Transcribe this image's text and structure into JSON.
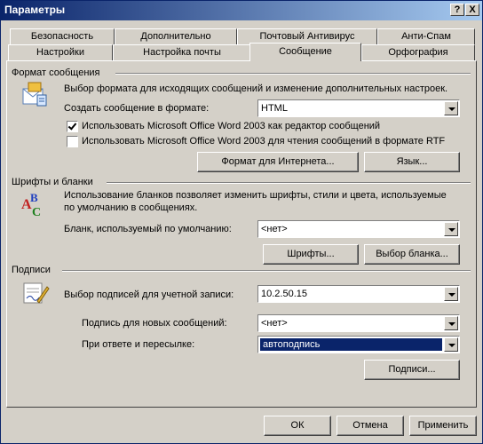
{
  "window": {
    "title": "Параметры",
    "help_label": "?",
    "close_label": "X"
  },
  "tabs_row1": [
    "Безопасность",
    "Дополнительно",
    "Почтовый Антивирус",
    "Анти-Спам"
  ],
  "tabs_row2": [
    "Настройки",
    "Настройка почты",
    "Сообщение",
    "Орфография"
  ],
  "active_tab": "Сообщение",
  "format": {
    "header": "Формат сообщения",
    "description": "Выбор формата для исходящих сообщений и изменение дополнительных настроек.",
    "create_label": "Создать сообщение в формате:",
    "create_value": "HTML",
    "use_word_editor_label": "Использовать Microsoft Office Word 2003 как редактор сообщений",
    "use_word_editor_checked": true,
    "use_word_reader_label": "Использовать Microsoft Office Word 2003 для чтения сообщений в формате RTF",
    "use_word_reader_checked": false,
    "internet_format_button": "Формат для Интернета...",
    "language_button": "Язык..."
  },
  "fonts": {
    "header": "Шрифты и бланки",
    "description_line1": "Использование бланков позволяет изменить шрифты, стили и цвета, используемые",
    "description_line2": "по умолчанию в сообщениях.",
    "stationery_label": "Бланк, используемый по умолчанию:",
    "stationery_value": "<нет>",
    "fonts_button": "Шрифты...",
    "select_stationery_button": "Выбор бланка..."
  },
  "signatures": {
    "header": "Подписи",
    "account_label": "Выбор подписей для учетной записи:",
    "account_value": "10.2.50.15",
    "new_messages_label": "Подпись для новых сообщений:",
    "new_messages_value": "<нет>",
    "replies_label": "При ответе и пересылке:",
    "replies_value": "автоподпись",
    "signatures_button": "Подписи..."
  },
  "footer": {
    "ok": "ОК",
    "cancel": "Отмена",
    "apply": "Применить"
  }
}
